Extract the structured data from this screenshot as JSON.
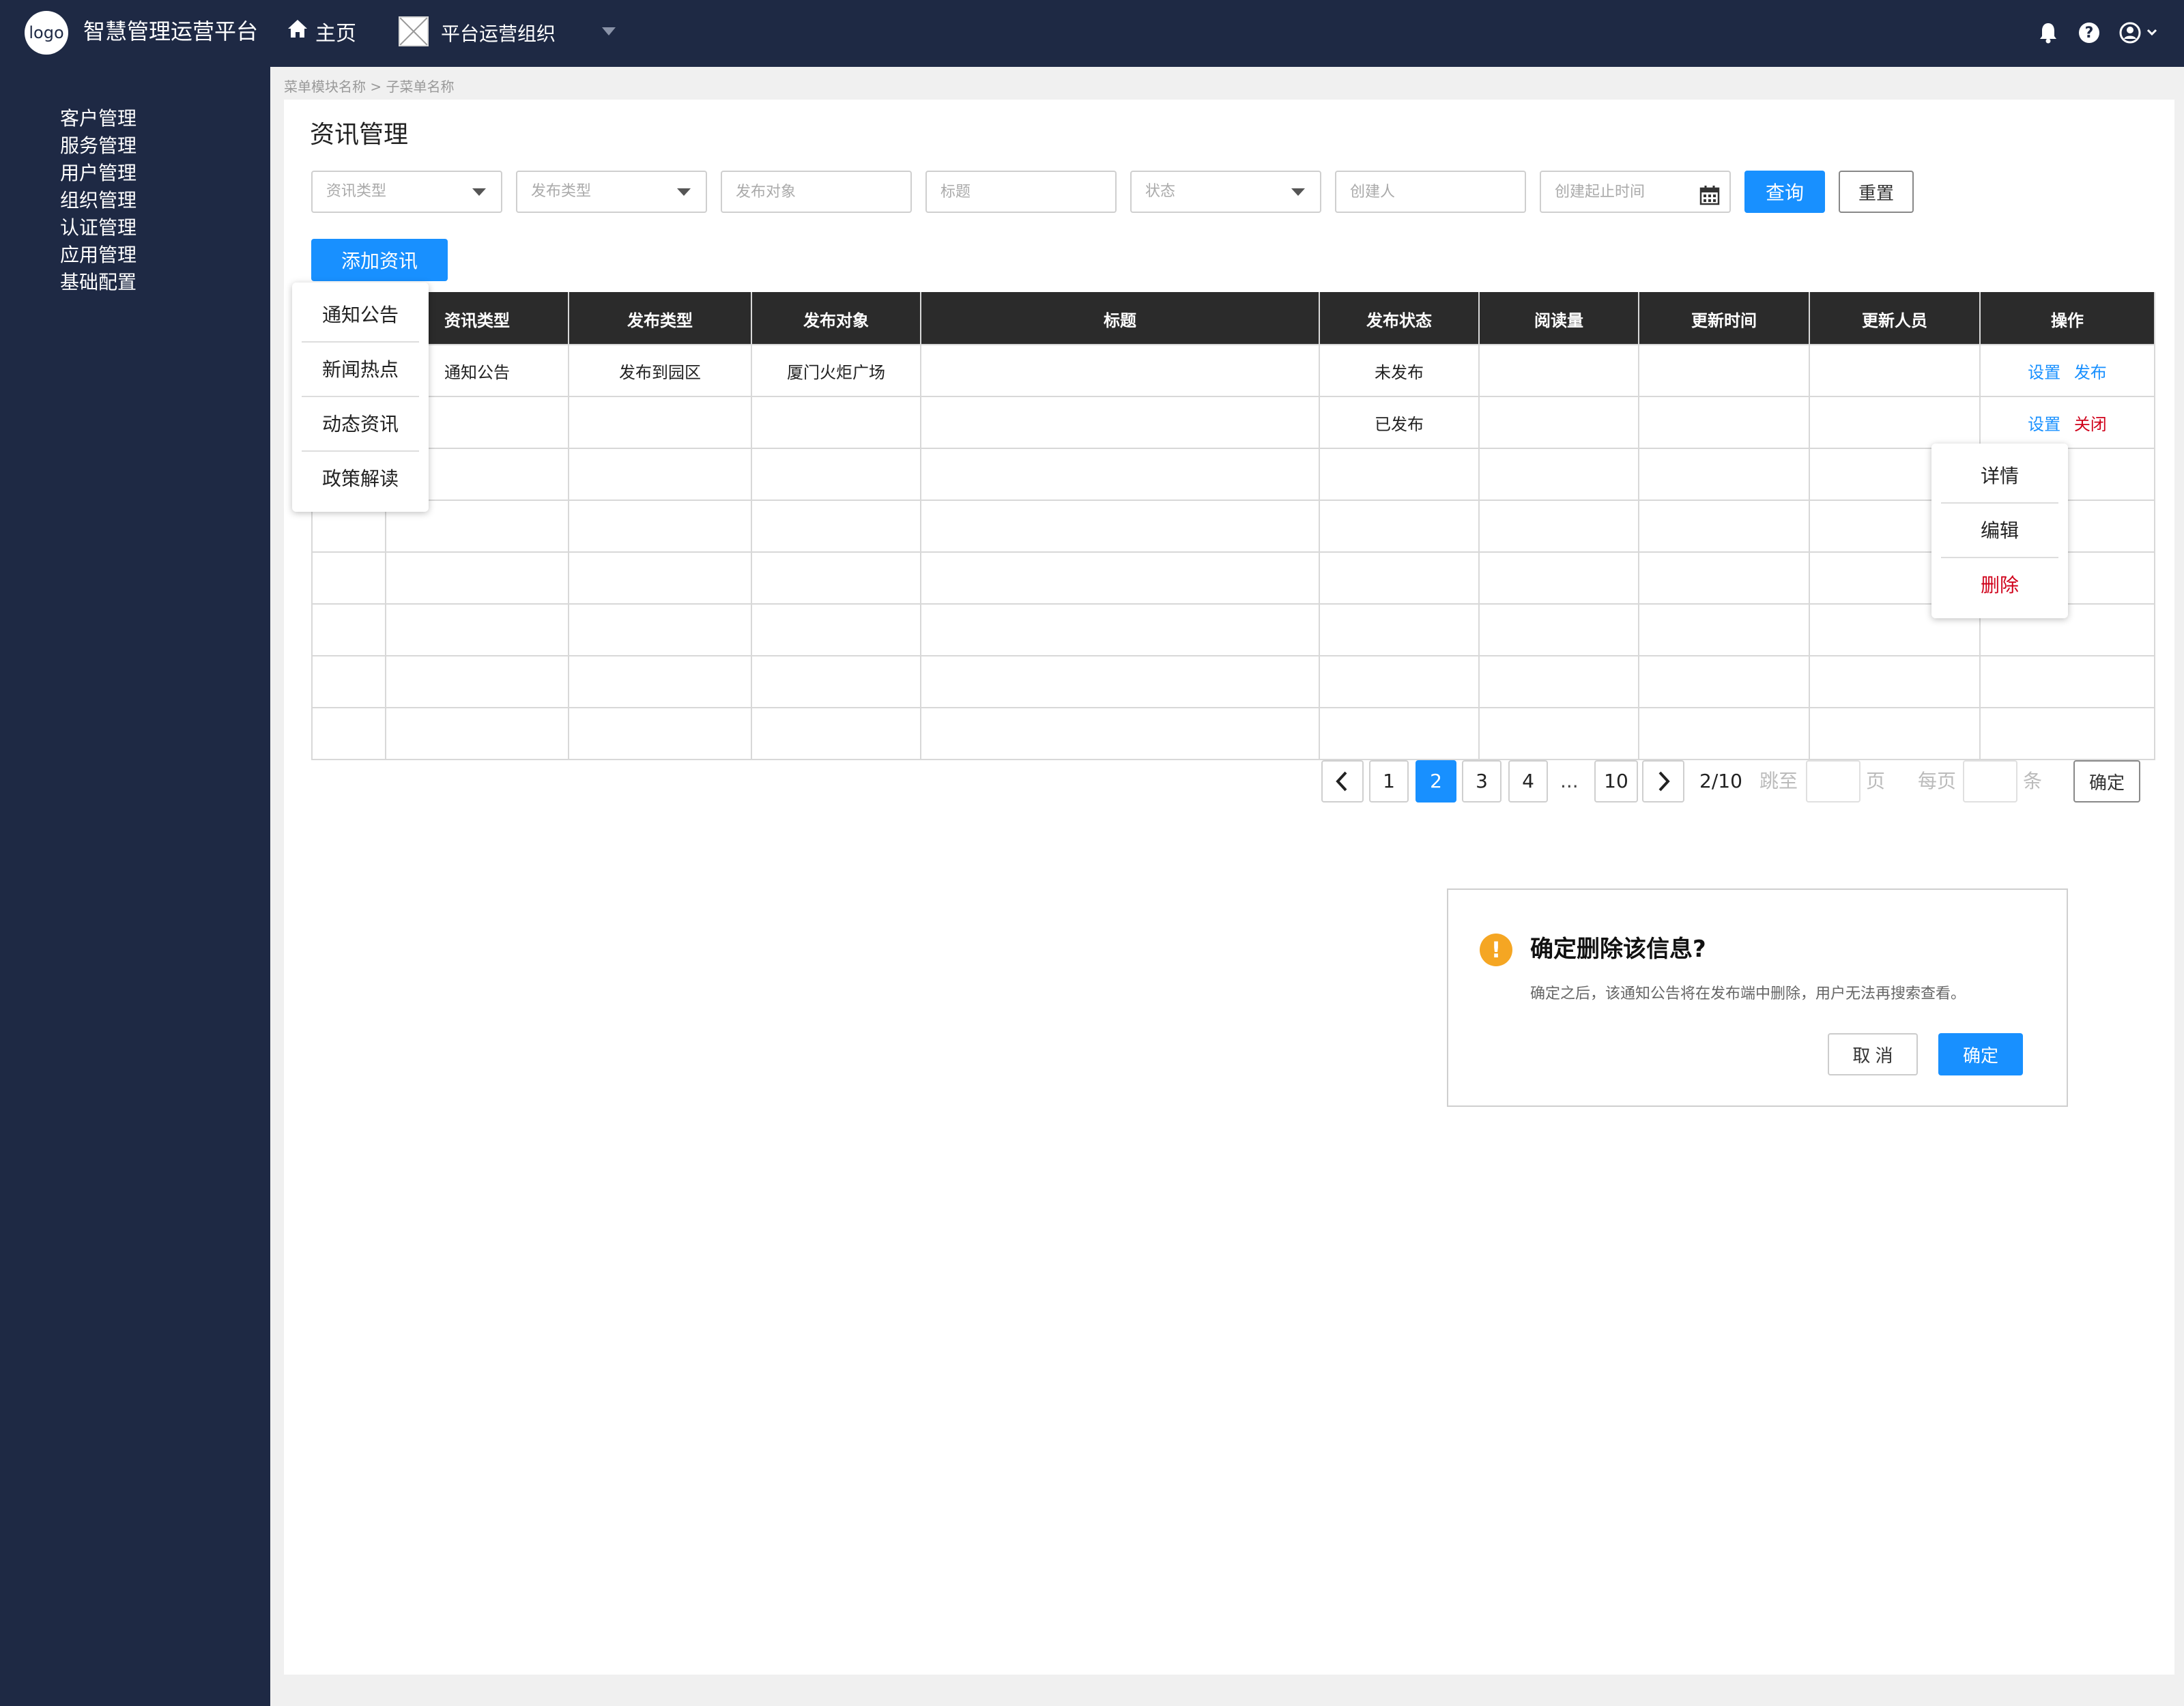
{
  "header": {
    "logo": "logo",
    "app_title": "智慧管理运营平台",
    "home_label": "主页",
    "org_name": "平台运营组织"
  },
  "sidebar": {
    "items": [
      "客户管理",
      "服务管理",
      "用户管理",
      "组织管理",
      "认证管理",
      "应用管理",
      "基础配置"
    ]
  },
  "breadcrumb": "菜单模块名称 > 子菜单名称",
  "page_title": "资讯管理",
  "filters": {
    "news_type": "资讯类型",
    "publish_type": "发布类型",
    "publish_target": "发布对象",
    "title": "标题",
    "status": "状态",
    "creator": "创建人",
    "date_range": "创建起止时间",
    "query_label": "查询",
    "reset_label": "重置"
  },
  "add_button": "添加资讯",
  "table": {
    "columns": [
      "",
      "资讯类型",
      "发布类型",
      "发布对象",
      "标题",
      "发布状态",
      "阅读量",
      "更新时间",
      "更新人员",
      "操作"
    ],
    "rows": [
      {
        "cells": [
          "",
          "通知公告",
          "发布到园区",
          "厦门火炬广场",
          "",
          "未发布",
          "",
          "",
          ""
        ],
        "actions": [
          "设置",
          "发布"
        ]
      },
      {
        "cells": [
          "",
          "",
          "",
          "",
          "",
          "已发布",
          "",
          "",
          ""
        ],
        "actions": [
          "设置",
          "关闭"
        ]
      }
    ]
  },
  "type_dropdown": [
    "通知公告",
    "新闻热点",
    "动态资讯",
    "政策解读"
  ],
  "action_dropdown": [
    "详情",
    "编辑",
    "删除"
  ],
  "pagination": {
    "pages": [
      "1",
      "2",
      "3",
      "4",
      "10"
    ],
    "current": "2",
    "ellipsis": "...",
    "summary": "2/10",
    "jump_label": "跳至",
    "page_unit": "页",
    "per_page_label": "每页",
    "item_unit": "条",
    "confirm_label": "确定"
  },
  "dialog": {
    "title": "确定删除该信息?",
    "message": "确定之后，该通知公告将在发布端中删除，用户无法再搜索查看。",
    "cancel_label": "取 消",
    "confirm_label": "确定"
  },
  "colors": {
    "nav_bg": "#1e2944",
    "primary": "#1890ff",
    "danger": "#d0021b",
    "warning": "#f5a623",
    "table_header": "#2b2b2b"
  }
}
